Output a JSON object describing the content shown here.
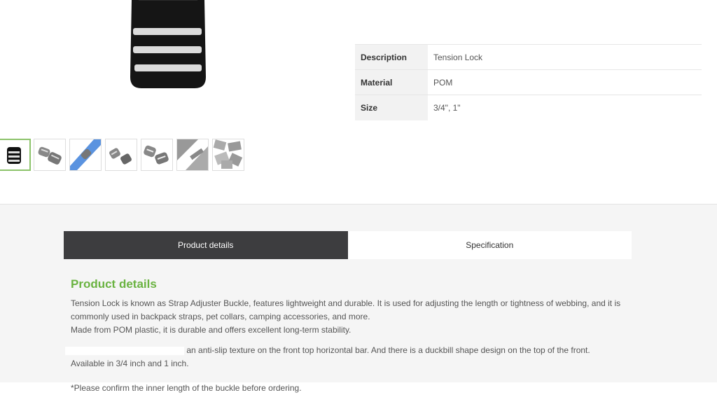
{
  "gallery": {
    "main_image_name": "tension-lock-buckle",
    "thumbnails": [
      {
        "name": "thumb-black-buckle",
        "active": true
      },
      {
        "name": "thumb-gray-buckle-pair"
      },
      {
        "name": "thumb-blue-strap"
      },
      {
        "name": "thumb-gray-buckle-angled"
      },
      {
        "name": "thumb-gray-buckle-front"
      },
      {
        "name": "thumb-buckle-closeup"
      },
      {
        "name": "thumb-buckle-pile"
      }
    ]
  },
  "specs": {
    "rows": [
      {
        "label": "Description",
        "value": "Tension Lock"
      },
      {
        "label": "Material",
        "value": "POM"
      },
      {
        "label": "Size",
        "value": "3/4\", 1\""
      }
    ]
  },
  "tabs": {
    "details": "Product details",
    "specification": "Specification"
  },
  "content": {
    "heading": "Product details",
    "para1_line1": "Tension Lock is known as Strap Adjuster Buckle, features lightweight and durable. It is used for adjusting the length or tightness of webbing, and it is",
    "para1_line2": "commonly used in backpack straps, pet collars, camping accessories, and more.",
    "para1_line3": "Made from POM plastic, it is durable and offers excellent long-term stability.",
    "para2_part": "an anti-slip texture on the front top horizontal bar. And there is a duckbill shape design on the top of the front.",
    "para2_line2": "Available in 3/4 inch and 1 inch.",
    "para3": "*Please confirm the inner length of the buckle before ordering."
  },
  "colors": {
    "accent_green": "#6ab341",
    "tab_active_bg": "#3d3d3f"
  }
}
